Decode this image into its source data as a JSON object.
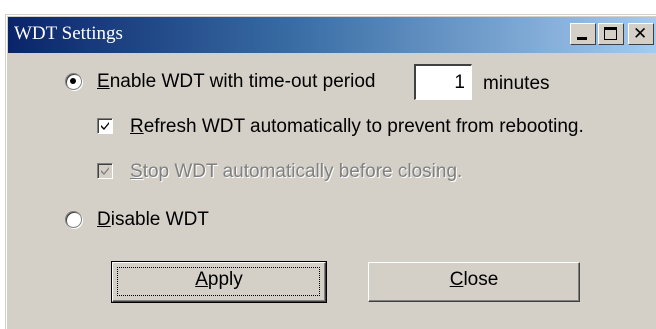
{
  "window": {
    "title": "WDT Settings",
    "controls": {
      "minimize": "minimize-icon",
      "maximize": "maximize-icon",
      "close": "close-icon"
    }
  },
  "enable_option": {
    "mnemonic": "E",
    "label_rest": "nable WDT with time-out period",
    "selected": true,
    "timeout_value": "1",
    "timeout_unit": "minutes"
  },
  "refresh_option": {
    "mnemonic": "R",
    "label_rest": "efresh WDT automatically to prevent from rebooting.",
    "checked": true
  },
  "stop_option": {
    "mnemonic": "S",
    "label_rest": "top WDT automatically before closing.",
    "checked": true,
    "disabled": true
  },
  "disable_option": {
    "mnemonic": "D",
    "label_rest": "isable WDT",
    "selected": false
  },
  "buttons": {
    "apply": {
      "mnemonic": "A",
      "rest": "pply"
    },
    "close": {
      "mnemonic": "C",
      "rest": "lose"
    }
  }
}
